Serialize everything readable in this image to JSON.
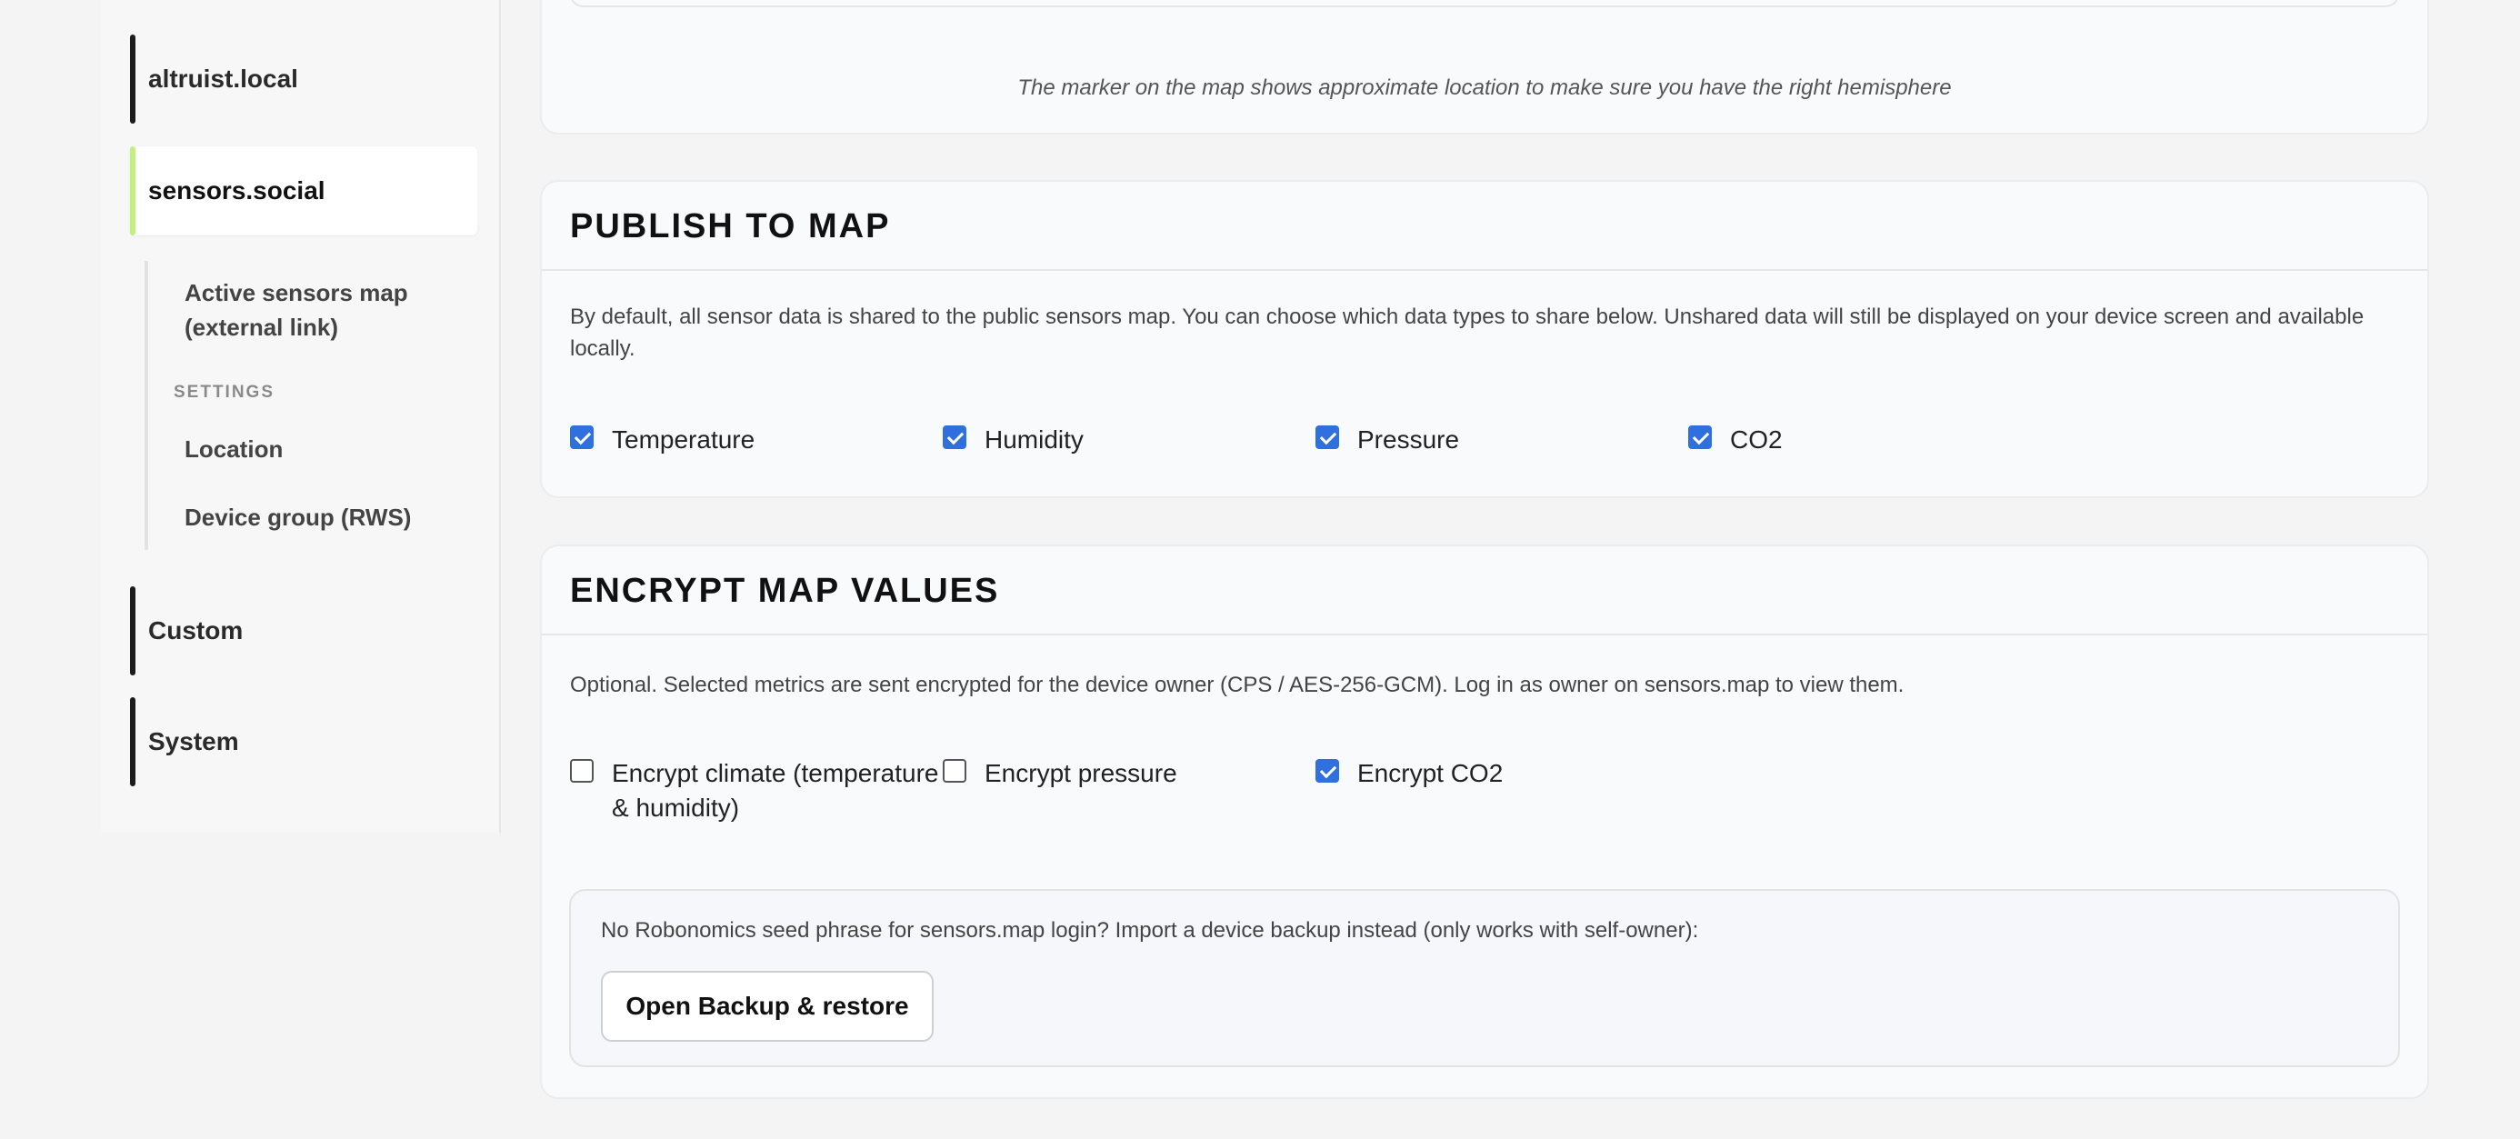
{
  "sidebar": {
    "groups": [
      {
        "label": "altruist.local",
        "active": false
      },
      {
        "label": "sensors.social",
        "active": true
      },
      {
        "label": "Custom",
        "active": false
      },
      {
        "label": "System",
        "active": false
      }
    ],
    "sub_items": {
      "active_map": "Active sensors map (external link)",
      "settings_heading": "SETTINGS",
      "location": "Location",
      "device_group": "Device group (RWS)"
    }
  },
  "location_card": {
    "note": "The marker on the map shows approximate location to make sure you have the right hemisphere"
  },
  "publish_card": {
    "title": "PUBLISH TO MAP",
    "description": "By default, all sensor data is shared to the public sensors map. You can choose which data types to share below. Unshared data will still be displayed on your device screen and available locally.",
    "options": [
      {
        "label": "Temperature",
        "checked": true
      },
      {
        "label": "Humidity",
        "checked": true
      },
      {
        "label": "Pressure",
        "checked": true
      },
      {
        "label": "CO2",
        "checked": true
      }
    ]
  },
  "encrypt_card": {
    "title": "ENCRYPT MAP VALUES",
    "description": "Optional. Selected metrics are sent encrypted for the device owner (CPS / AES-256-GCM). Log in as owner on sensors.map to view them.",
    "options": [
      {
        "label": "Encrypt climate (temperature & humidity)",
        "checked": false
      },
      {
        "label": "Encrypt pressure",
        "checked": false
      },
      {
        "label": "Encrypt CO2",
        "checked": true
      }
    ],
    "backup_text": "No Robonomics seed phrase for sensors.map login? Import a device backup instead (only works with self-owner):",
    "backup_button": "Open Backup & restore"
  },
  "colors": {
    "accent_checkbox": "#2f6fde",
    "active_nav_marker": "#c2ef7e",
    "nav_marker": "#1c1c1c"
  }
}
